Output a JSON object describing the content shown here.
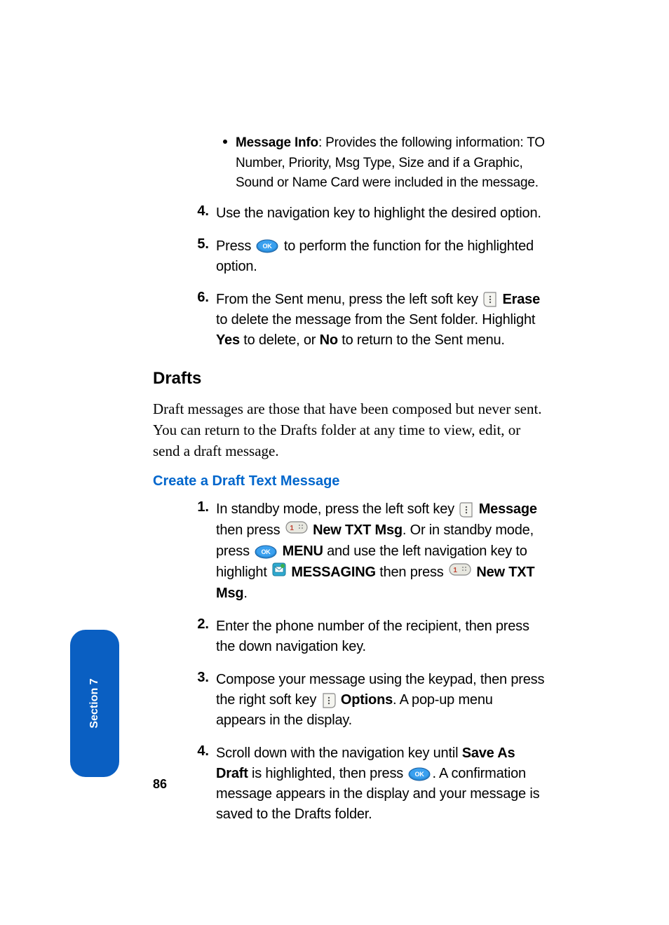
{
  "bullet": {
    "label": "Message Info",
    "rest": ": Provides the following information: TO Number, Priority, Msg Type, Size and if a Graphic, Sound or Name Card were included in the message."
  },
  "s4": {
    "num": "4.",
    "text": "Use the navigation key to highlight the desired option."
  },
  "s5": {
    "num": "5.",
    "before": "Press ",
    "after": " to perform the function for the highlighted option."
  },
  "s6": {
    "num": "6.",
    "a": "From the Sent menu, press the left soft key ",
    "erase": "Erase",
    "b": " to delete the message from the Sent folder. Highlight ",
    "yes": "Yes",
    "c": " to delete, or ",
    "no": "No",
    "d": " to return to the Sent menu."
  },
  "drafts": {
    "heading": "Drafts",
    "para": "Draft messages are those that have been composed but never sent. You can return to the Drafts folder at any time to view, edit, or send a draft message."
  },
  "create": {
    "heading": "Create a Draft Text Message"
  },
  "c1": {
    "num": "1.",
    "a": "In standby mode, press the left soft key ",
    "message": "Message",
    "b": " then press ",
    "newtxt1": "New TXT Msg",
    "c": ". Or in standby mode, press ",
    "menu": "MENU",
    "d": " and use the left navigation key to highlight ",
    "messaging": "MESSAGING",
    "e": " then press ",
    "newtxt2": "New TXT Msg",
    "f": "."
  },
  "c2": {
    "num": "2.",
    "text": "Enter the phone number of the recipient, then press the down navigation key."
  },
  "c3": {
    "num": "3.",
    "a": "Compose your message using the keypad, then press the right soft key ",
    "options": "Options",
    "b": ". A pop-up menu appears in the display."
  },
  "c4": {
    "num": "4.",
    "a": "Scroll down with the navigation key until ",
    "save": "Save As Draft",
    "b": " is highlighted, then press ",
    "c": ". A confirmation message appears in the display and your message is saved to the Drafts folder."
  },
  "side": {
    "label": "Section 7"
  },
  "page": {
    "num": "86"
  }
}
